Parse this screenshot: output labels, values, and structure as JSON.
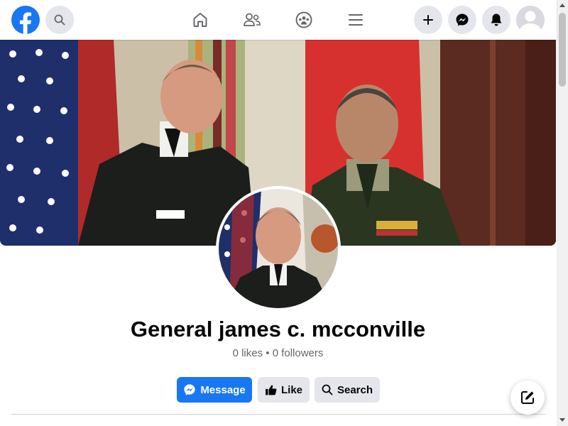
{
  "brand": {
    "color": "#1877f2"
  },
  "topbar": {
    "icons": [
      "facebook-logo",
      "search-icon",
      "home-icon",
      "friends-icon",
      "groups-icon",
      "menu-icon",
      "plus-icon",
      "messenger-icon",
      "bell-icon",
      "avatar"
    ]
  },
  "profile": {
    "name": "General james c. mcconville",
    "stats": "0 likes • 0 followers"
  },
  "actions": {
    "message_label": "Message",
    "like_label": "Like",
    "search_label": "Search"
  }
}
